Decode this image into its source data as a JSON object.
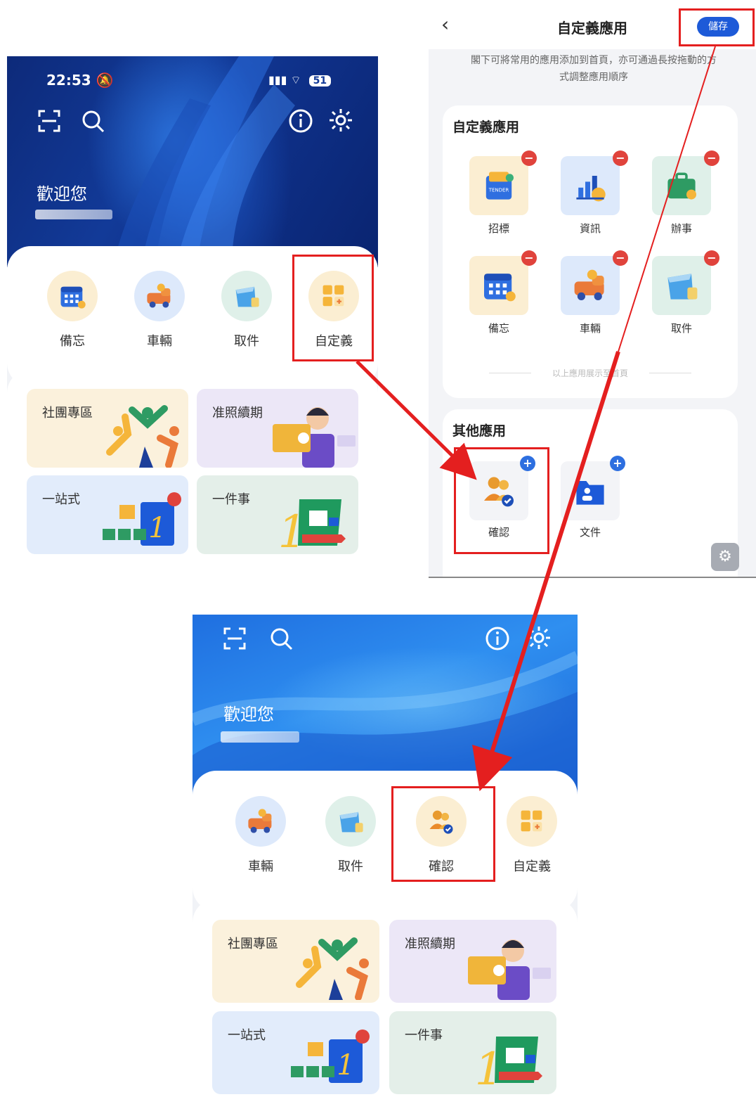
{
  "screen1": {
    "status": {
      "time": "22:53",
      "battery": "51"
    },
    "welcome": "歡迎您",
    "apps": [
      {
        "label": "備忘",
        "icon": "calendar-icon"
      },
      {
        "label": "車輛",
        "icon": "vehicle-icon"
      },
      {
        "label": "取件",
        "icon": "parcel-icon"
      },
      {
        "label": "自定義",
        "icon": "customize-icon"
      }
    ],
    "tiles": [
      {
        "title": "社團專區"
      },
      {
        "title": "准照續期"
      },
      {
        "title": "一站式"
      },
      {
        "title": "一件事"
      }
    ]
  },
  "screen2": {
    "nav_title": "自定義應用",
    "save_label": "儲存",
    "hint": "閣下可將常用的應用添加到首頁，亦可通過長按拖動的方式調整應用順序",
    "custom_section_title": "自定義應用",
    "custom_apps": [
      {
        "label": "招標",
        "icon": "tender-icon"
      },
      {
        "label": "資訊",
        "icon": "info-chart-icon"
      },
      {
        "label": "辦事",
        "icon": "briefcase-icon"
      },
      {
        "label": "備忘",
        "icon": "calendar-icon"
      },
      {
        "label": "車輛",
        "icon": "vehicle-icon"
      },
      {
        "label": "取件",
        "icon": "parcel-icon"
      }
    ],
    "divider_note": "以上應用展示至首頁",
    "other_section_title": "其他應用",
    "other_apps": [
      {
        "label": "確認",
        "icon": "confirm-users-icon"
      },
      {
        "label": "文件",
        "icon": "document-folder-icon"
      }
    ]
  },
  "screen3": {
    "welcome": "歡迎您",
    "apps": [
      {
        "label": "車輛",
        "icon": "vehicle-icon"
      },
      {
        "label": "取件",
        "icon": "parcel-icon"
      },
      {
        "label": "確認",
        "icon": "confirm-users-icon"
      },
      {
        "label": "自定義",
        "icon": "customize-icon"
      }
    ],
    "tiles": [
      {
        "title": "社團專區"
      },
      {
        "title": "准照續期"
      },
      {
        "title": "一站式"
      },
      {
        "title": "一件事"
      }
    ]
  },
  "colors": {
    "highlight": "#e41f1f",
    "accent": "#1d5ad8"
  }
}
